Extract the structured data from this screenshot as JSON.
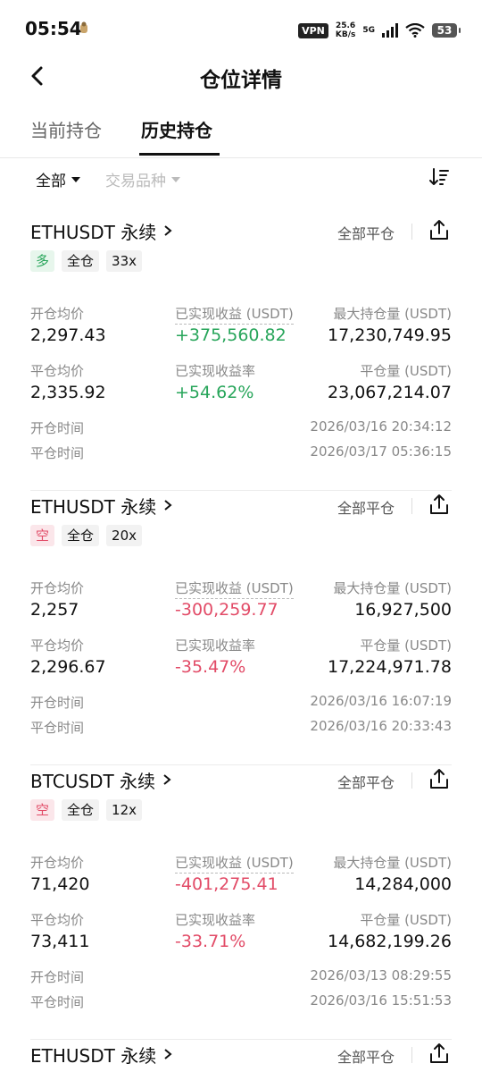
{
  "status": {
    "time": "05:54",
    "vpn": "VPN",
    "speed_value": "25.6",
    "speed_unit": "KB/s",
    "net": "5G",
    "battery": "53"
  },
  "header": {
    "title": "仓位详情"
  },
  "tabs": [
    {
      "label": "当前持仓"
    },
    {
      "label": "历史持仓"
    }
  ],
  "filters": {
    "all": "全部",
    "instrument": "交易品种"
  },
  "labels": {
    "close_all": "全部平仓",
    "open_avg": "开仓均价",
    "close_avg": "平仓均价",
    "realized_pnl": "已实现收益 (USDT)",
    "realized_rate": "已实现收益率",
    "max_position": "最大持仓量 (USDT)",
    "close_qty": "平仓量 (USDT)",
    "open_time": "开仓时间",
    "close_time": "平仓时间"
  },
  "cards": [
    {
      "symbol": "ETHUSDT 永续",
      "side": "多",
      "margin": "全仓",
      "leverage": "33x",
      "open_avg": "2,297.43",
      "pnl": "+375,560.82",
      "max_position": "17,230,749.95",
      "close_avg": "2,335.92",
      "rate": "+54.62%",
      "close_qty": "23,067,214.07",
      "open_time": "2026/03/16 20:34:12",
      "close_time": "2026/03/17 05:36:15"
    },
    {
      "symbol": "ETHUSDT 永续",
      "side": "空",
      "margin": "全仓",
      "leverage": "20x",
      "open_avg": "2,257",
      "pnl": "-300,259.77",
      "max_position": "16,927,500",
      "close_avg": "2,296.67",
      "rate": "-35.47%",
      "close_qty": "17,224,971.78",
      "open_time": "2026/03/16 16:07:19",
      "close_time": "2026/03/16 20:33:43"
    },
    {
      "symbol": "BTCUSDT 永续",
      "side": "空",
      "margin": "全仓",
      "leverage": "12x",
      "open_avg": "71,420",
      "pnl": "-401,275.41",
      "max_position": "14,284,000",
      "close_avg": "73,411",
      "rate": "-33.71%",
      "close_qty": "14,682,199.26",
      "open_time": "2026/03/13 08:29:55",
      "close_time": "2026/03/16 15:51:53"
    },
    {
      "symbol": "ETHUSDT 永续"
    }
  ]
}
